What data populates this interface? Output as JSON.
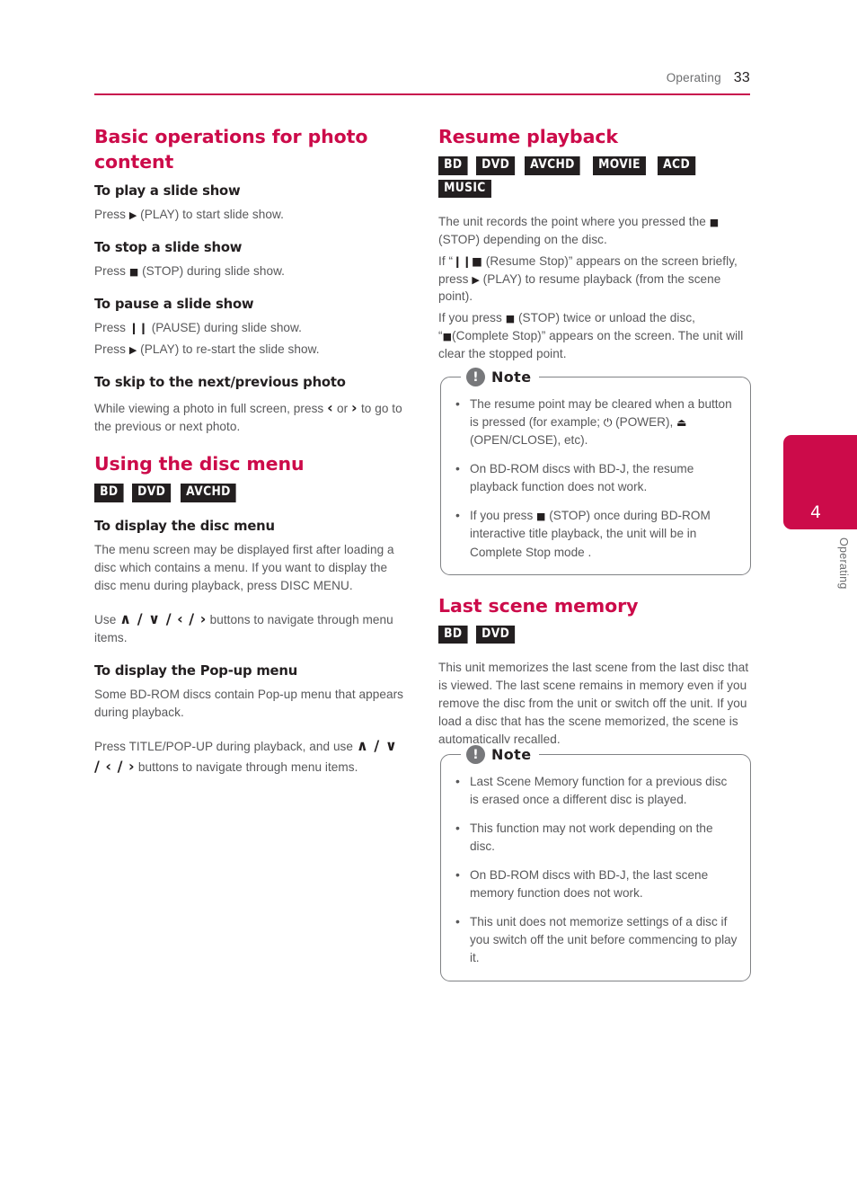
{
  "header": {
    "section": "Operating",
    "page_number": "33",
    "rule_color": "#c8104d"
  },
  "chapter_tab": {
    "number": "4",
    "label": "Operating",
    "color": "#cc0b4a"
  },
  "left_column": {
    "title": "Basic operations for photo content",
    "sections": [
      {
        "heading": "To play a slide show",
        "body_pre": "Press ",
        "glyph": "▶",
        "body_post": " (PLAY) to start slide show."
      },
      {
        "heading": "To stop a slide show",
        "body_pre": "Press ",
        "glyph": "■",
        "body_post": " (STOP) during slide show."
      },
      {
        "heading": "To pause a slide show",
        "line1_pre": "Press ",
        "line1_glyph": "❙❙",
        "line1_post": " (PAUSE) during slide show.",
        "line2_pre": "Press ",
        "line2_glyph": "▶",
        "line2_post": " (PLAY) to re-start the slide show."
      },
      {
        "heading": "To skip to the next/previous photo",
        "body_pre": "While viewing a photo in full screen, press ",
        "glyph_a": "‹",
        "mid": " or ",
        "glyph_b": "›",
        "body_post": " to go to the previous or next photo."
      }
    ],
    "disc_menu": {
      "title": "Using the disc menu",
      "badges": [
        "BD",
        "DVD",
        "AVCHD"
      ],
      "display_disc_menu": {
        "heading": "To display the disc menu",
        "para1": "The menu screen may be displayed first after loading a disc which contains a menu. If you want to display the disc menu during playback, press DISC MENU.",
        "para2_pre": "Use ",
        "para2_nav": "∧ / ∨ / ‹ / ›",
        "para2_post": " buttons to navigate through menu items."
      },
      "display_popup_menu": {
        "heading": "To display the Pop-up menu",
        "para1": "Some BD-ROM discs contain Pop-up menu that appears during playback.",
        "para2_pre": "Press TITLE/POP-UP during playback, and use ",
        "para2_nav": "∧ / ∨ / ‹ / ›",
        "para2_post": " buttons to navigate through menu items."
      }
    }
  },
  "right_column": {
    "resume": {
      "title": "Resume playback",
      "badges": [
        "BD",
        "DVD",
        "AVCHD",
        "MOVIE",
        "ACD",
        "MUSIC"
      ],
      "line1_pre": "The unit records the point where you pressed the ",
      "line1_glyph": "■",
      "line1_post": " (STOP) depending on the disc.",
      "line2_pre": "If “",
      "line2_glyph": "❙❙■",
      "line2_mid": " (Resume Stop)” appears on the screen briefly, press ",
      "line2_glyph2": "▶",
      "line2_post": " (PLAY) to resume playback (from the scene point).",
      "line3_pre": "If you press ",
      "line3_glyph": "■",
      "line3_mid": " (STOP) twice or unload the disc, “",
      "line3_glyph2": "■",
      "line3_post": "(Complete Stop)” appears on the screen. The unit will clear the stopped point.",
      "note": {
        "title": "Note",
        "icon": "!",
        "items": [
          {
            "pre": "The resume point may be cleared when a button is pressed (for example; ",
            "glyph_a": "⏻",
            "mid": " (POWER), ",
            "glyph_b": "⏏",
            "post": " (OPEN/CLOSE), etc)."
          },
          {
            "pre": "On BD-ROM discs with BD-J, the resume playback function does not work."
          },
          {
            "pre": "If you press ",
            "glyph_a": "■",
            "post": " (STOP) once during BD-ROM interactive title playback, the unit will be in Complete Stop mode ."
          }
        ]
      }
    },
    "last_scene": {
      "title": "Last scene memory",
      "badges": [
        "BD",
        "DVD"
      ],
      "body": "This unit memorizes the last scene from the last disc that is viewed. The last scene remains in memory even if you remove the disc from the unit or switch off the unit. If you load a disc that has the scene memorized, the scene is automatically recalled.",
      "note": {
        "title": "Note",
        "icon": "!",
        "items": [
          "Last Scene Memory function for a previous disc is erased once a different disc is played.",
          "This function may not work depending on the disc.",
          "On BD-ROM discs with BD-J, the last scene memory function does not work.",
          "This unit does not memorize settings of a disc if you switch off the unit before commencing to play it."
        ]
      }
    }
  }
}
